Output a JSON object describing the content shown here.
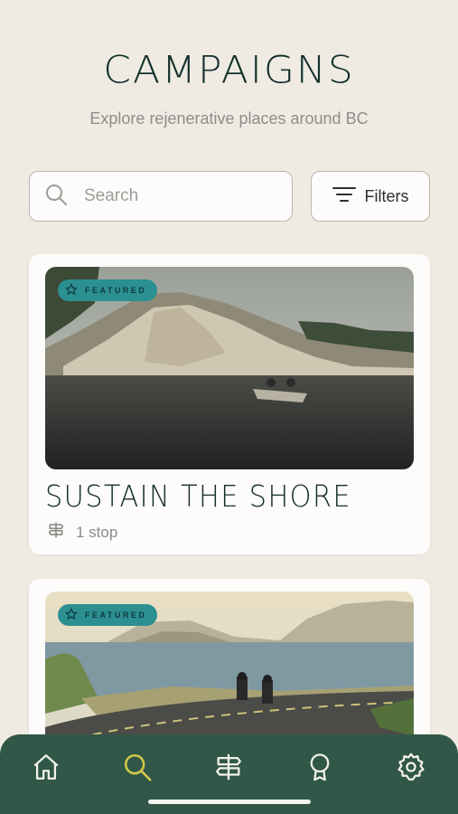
{
  "header": {
    "title": "CAMPAIGNS",
    "subtitle": "Explore rejenerative places around BC"
  },
  "search": {
    "placeholder": "Search",
    "icon": "search-icon"
  },
  "filters": {
    "label": "Filters",
    "icon": "filter-lines-icon"
  },
  "campaigns": [
    {
      "badge": "FEATURED",
      "title": "SUSTAIN THE SHORE",
      "stops": "1 stop"
    },
    {
      "badge": "FEATURED"
    }
  ],
  "tabbar": {
    "active": "explore",
    "items": [
      "home",
      "explore",
      "signpost",
      "rewards",
      "settings"
    ],
    "icon_color": "#f3f1ea",
    "active_color": "#d2c94a"
  },
  "colors": {
    "background": "#efebe3",
    "accent": "#2c8f92",
    "tabbar": "#305747",
    "title": "#13302b"
  }
}
